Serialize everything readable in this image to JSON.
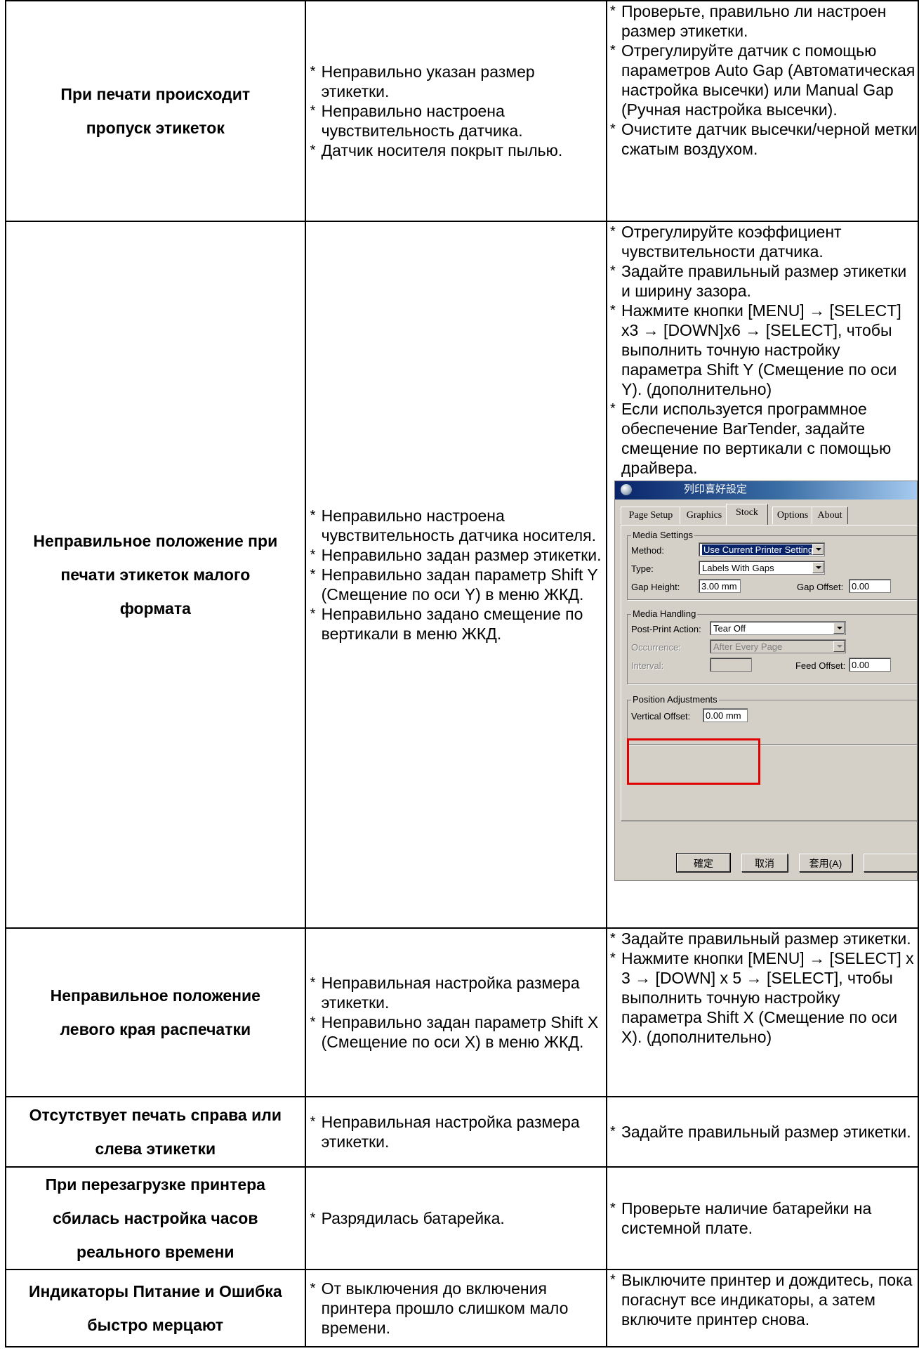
{
  "rows": [
    {
      "problem": [
        "При печати происходит",
        "пропуск этикеток"
      ],
      "causes": [
        "Неправильно указан размер этикетки.",
        "Неправильно настроена чувствительность датчика.",
        "Датчик носителя покрыт пылью."
      ],
      "fixes": [
        "Проверьте, правильно ли настроен размер этикетки.",
        "Отрегулируйте датчик с помощью параметров Auto Gap (Автоматическая настройка высечки) или Manual Gap (Ручная настройка высечки).",
        "Очистите датчик высечки/черной метки сжатым воздухом."
      ]
    },
    {
      "problem": [
        "Неправильное положение при",
        "печати этикеток малого",
        "формата"
      ],
      "causes": [
        "Неправильно настроена чувствительность датчика носителя.",
        "Неправильно задан размер этикетки.",
        "Неправильно задан параметр Shift Y (Смещение по оси Y) в меню ЖКД.",
        "Неправильно задано смещение по вертикали в меню ЖКД."
      ],
      "fixes": [
        "Отрегулируйте коэффициент чувствительности датчика.",
        "Задайте правильный размер этикетки и ширину зазора.",
        "Нажмите кнопки [MENU] → [SELECT] x3 → [DOWN]x6 → [SELECT], чтобы выполнить точную настройку параметра Shift Y (Смещение по оси Y). (дополнительно)",
        "Если используется программное обеспечение BarTender, задайте смещение по вертикали с помощью драйвера."
      ]
    },
    {
      "problem": [
        "Неправильное положение",
        "левого края распечатки"
      ],
      "causes": [
        "Неправильная настройка размера этикетки.",
        "Неправильно задан параметр Shift X (Смещение по оси X) в меню ЖКД."
      ],
      "fixes": [
        "Задайте правильный размер этикетки.",
        "Нажмите кнопки [MENU] → [SELECT] x 3 → [DOWN] x 5 → [SELECT], чтобы выполнить точную настройку параметра Shift X (Смещение по оси X). (дополнительно)"
      ]
    },
    {
      "problem": [
        "Отсутствует печать справа или",
        "слева этикетки"
      ],
      "causes": [
        "Неправильная настройка размера этикетки."
      ],
      "fixes": [
        "Задайте правильный размер этикетки."
      ]
    },
    {
      "problem": [
        "При перезагрузке принтера",
        "сбилась настройка часов",
        "реального времени"
      ],
      "causes": [
        "Разрядилась батарейка."
      ],
      "fixes": [
        "Проверьте наличие батарейки на системной плате."
      ]
    },
    {
      "problem": [
        "Индикаторы Питание и Ошибка",
        "быстро мерцают"
      ],
      "causes": [
        "От выключения до включения принтера прошло слишком мало времени."
      ],
      "fixes": [
        "Выключите принтер и дождитесь, пока погаснут все индикаторы, а затем включите принтер снова."
      ]
    }
  ],
  "bullet": "*",
  "dialog": {
    "title": "列印喜好設定",
    "tabs": [
      "Page Setup",
      "Graphics",
      "Stock",
      "Options",
      "About"
    ],
    "media_settings": {
      "label": "Media Settings",
      "method_label": "Method:",
      "method_value": "Use Current Printer Setting",
      "type_label": "Type:",
      "type_value": "Labels With Gaps",
      "gap_height_label": "Gap Height:",
      "gap_height_value": "3.00 mm",
      "gap_offset_label": "Gap Offset:",
      "gap_offset_value": "0.00"
    },
    "media_handling": {
      "label": "Media Handling",
      "post_print_label": "Post-Print Action:",
      "post_print_value": "Tear Off",
      "occurrence_label": "Occurrence:",
      "occurrence_value": "After Every Page",
      "interval_label": "Interval:",
      "feed_offset_label": "Feed Offset:",
      "feed_offset_value": "0.00"
    },
    "position_adjustments": {
      "label": "Position Adjustments",
      "vertical_offset_label": "Vertical Offset:",
      "vertical_offset_value": "0.00 mm"
    },
    "buttons": [
      "確定",
      "取消",
      "套用(A)"
    ],
    "highlight_color": "#e00000"
  }
}
